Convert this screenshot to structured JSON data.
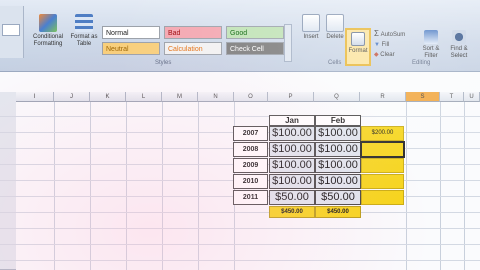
{
  "ribbon": {
    "conditional_formatting": "Conditional Formatting",
    "format_as_table": "Format as Table",
    "styles": [
      {
        "label": "Normal",
        "bg": "#ffffff",
        "fg": "#222222"
      },
      {
        "label": "Bad",
        "bg": "#f4a6b0",
        "fg": "#9c0006"
      },
      {
        "label": "Good",
        "bg": "#bfe2b4",
        "fg": "#006100"
      },
      {
        "label": "Neutral",
        "bg": "#f8cf7a",
        "fg": "#9c6500"
      },
      {
        "label": "Calculation",
        "bg": "#f2f2f2",
        "fg": "#e46c0a"
      },
      {
        "label": "Check Cell",
        "bg": "#7a7a7a",
        "fg": "#ffffff"
      }
    ],
    "styles_group_label": "Styles",
    "insert": "Insert",
    "delete": "Delete",
    "format": "Format",
    "cells_group_label": "Cells",
    "autosum": "AutoSum",
    "fill": "Fill",
    "clear": "Clear",
    "sort_filter": "Sort & Filter",
    "find_select": "Find & Select",
    "editing_group_label": "Editing"
  },
  "columns": [
    "I",
    "J",
    "K",
    "L",
    "M",
    "N",
    "O",
    "P",
    "Q",
    "R",
    "S",
    "T",
    "U"
  ],
  "active_column": "S",
  "table": {
    "headers": [
      "Jan",
      "Feb"
    ],
    "rows": [
      {
        "year": "2007",
        "jan": "$100.00",
        "feb": "$100.00",
        "extra": "$200.00"
      },
      {
        "year": "2008",
        "jan": "$100.00",
        "feb": "$100.00",
        "extra": ""
      },
      {
        "year": "2009",
        "jan": "$100.00",
        "feb": "$100.00",
        "extra": ""
      },
      {
        "year": "2010",
        "jan": "$100.00",
        "feb": "$100.00",
        "extra": ""
      },
      {
        "year": "2011",
        "jan": "$50.00",
        "feb": "$50.00",
        "extra": ""
      }
    ],
    "totals": {
      "jan": "$450.00",
      "feb": "$450.00"
    }
  }
}
